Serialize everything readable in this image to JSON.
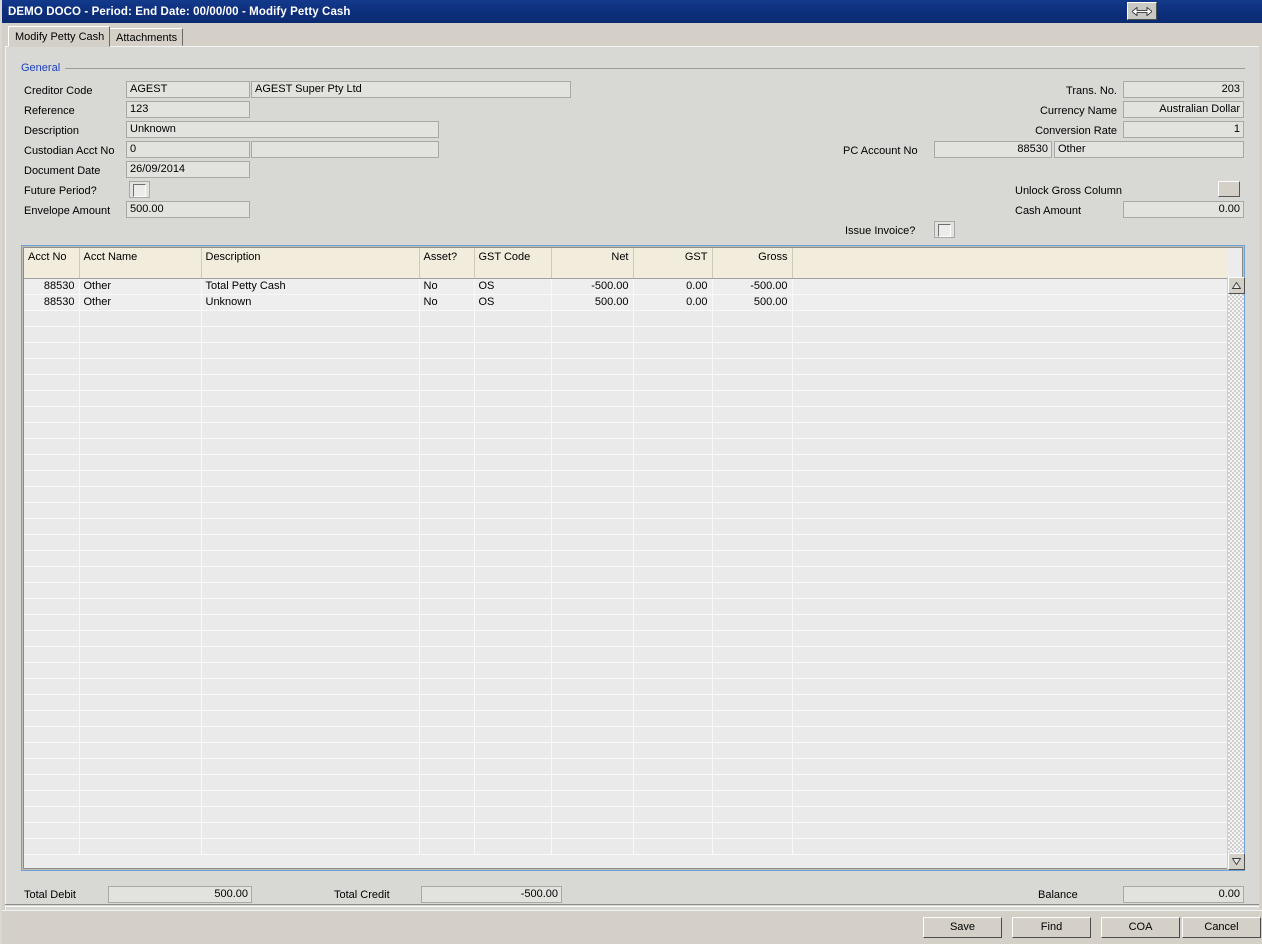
{
  "window": {
    "title": "DEMO DOCO  - Period:   End Date: 00/00/00 - Modify Petty Cash",
    "restore_button_icon": "resize-horizontal-icon"
  },
  "tabs": [
    {
      "label": "Modify Petty Cash",
      "active": true
    },
    {
      "label": "Attachments",
      "active": false
    }
  ],
  "general": {
    "group_label": "General",
    "left_fields": [
      {
        "label": "Creditor Code",
        "value": "AGEST",
        "value2": "AGEST Super Pty Ltd"
      },
      {
        "label": "Reference",
        "value": "123"
      },
      {
        "label": "Description",
        "value": "Unknown"
      },
      {
        "label": "Custodian Acct No",
        "value": "0",
        "value2": ""
      },
      {
        "label": "Document Date",
        "value": "26/09/2014"
      },
      {
        "label": "Future Period?",
        "checkbox": false
      },
      {
        "label": "Envelope Amount",
        "value": "500.00"
      }
    ],
    "right_fields": [
      {
        "label": "Trans. No.",
        "value": "203"
      },
      {
        "label": "Currency Name",
        "value": "Australian Dollar"
      },
      {
        "label": "Conversion Rate",
        "value": "1"
      },
      {
        "label": "PC Account No",
        "value": "88530",
        "value2": "Other"
      },
      {
        "label": "Unlock Gross Column",
        "button": true
      },
      {
        "label": "Cash Amount",
        "value": "0.00"
      },
      {
        "label": "Issue Invoice?",
        "checkbox": false
      }
    ]
  },
  "grid": {
    "columns": [
      {
        "key": "acct_no",
        "label": "Acct No",
        "align": "right"
      },
      {
        "key": "acct_name",
        "label": "Acct Name",
        "align": "left"
      },
      {
        "key": "description",
        "label": "Description",
        "align": "left"
      },
      {
        "key": "asset",
        "label": "Asset?",
        "align": "left"
      },
      {
        "key": "gst_code",
        "label": "GST Code",
        "align": "left"
      },
      {
        "key": "net",
        "label": "Net",
        "align": "right"
      },
      {
        "key": "gst",
        "label": "GST",
        "align": "right"
      },
      {
        "key": "gross",
        "label": "Gross",
        "align": "right"
      }
    ],
    "rows": [
      {
        "acct_no": "88530",
        "acct_name": "Other",
        "description": "Total Petty Cash",
        "asset": "No",
        "gst_code": "OS",
        "net": "-500.00",
        "gst": "0.00",
        "gross": "-500.00"
      },
      {
        "acct_no": "88530",
        "acct_name": "Other",
        "description": "Unknown",
        "asset": "No",
        "gst_code": "OS",
        "net": "500.00",
        "gst": "0.00",
        "gross": "500.00"
      }
    ],
    "empty_row_count": 34,
    "scroll_up_icon": "scroll-up-arrow-icon",
    "scroll_down_icon": "scroll-down-arrow-icon"
  },
  "totals": {
    "total_debit_label": "Total Debit",
    "total_debit_value": "500.00",
    "total_credit_label": "Total Credit",
    "total_credit_value": "-500.00",
    "balance_label": "Balance",
    "balance_value": "0.00"
  },
  "buttons": {
    "save": "Save",
    "find": "Find",
    "coa": "COA",
    "cancel": "Cancel"
  },
  "colors": {
    "titlebar": "#0d2f7c",
    "group_label": "#1c3fbe",
    "grid_border": "#6f9fd8",
    "grid_header": "#f2ecdd",
    "face": "#d4d0c8"
  }
}
